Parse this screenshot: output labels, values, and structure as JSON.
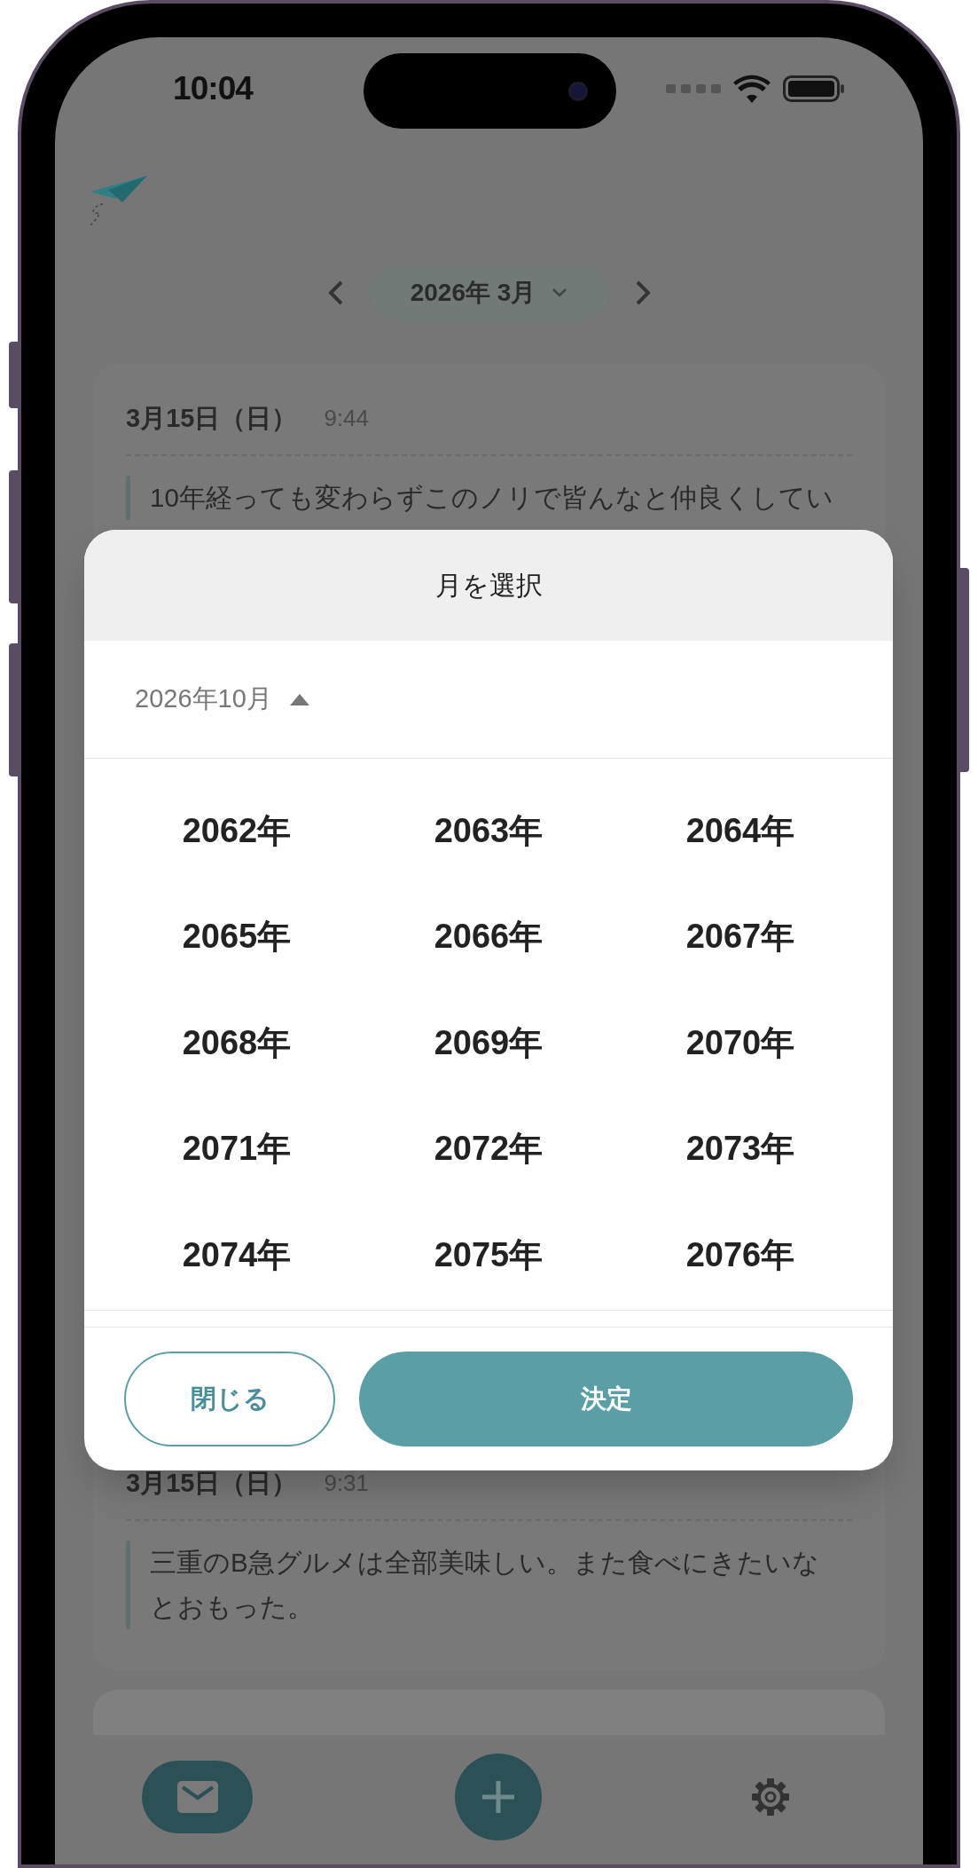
{
  "status_bar": {
    "time": "10:04"
  },
  "month_nav": {
    "label": "2026年 3月"
  },
  "entries": [
    {
      "date": "3月15日（日）",
      "time": "9:44",
      "text": "10年経っても変わらずこのノリで皆んなと仲良くしてい"
    },
    {
      "date": "3月15日（日）",
      "time": "9:31",
      "text": "三重のB急グルメは全部美味しい。また食べにきたいなとおもった。"
    }
  ],
  "dialog": {
    "title": "月を選択",
    "current": "2026年10月",
    "expanded": true,
    "years": [
      "2062年",
      "2063年",
      "2064年",
      "2065年",
      "2066年",
      "2067年",
      "2068年",
      "2069年",
      "2070年",
      "2071年",
      "2072年",
      "2073年",
      "2074年",
      "2075年",
      "2076年"
    ],
    "buttons": [
      {
        "label": "閉じる",
        "kind": "outline"
      },
      {
        "label": "決定",
        "kind": "primary"
      }
    ]
  },
  "bottom_nav": [
    {
      "kind": "mail",
      "selected": true
    },
    {
      "kind": "add",
      "selected": false
    },
    {
      "kind": "settings",
      "selected": false
    }
  ]
}
